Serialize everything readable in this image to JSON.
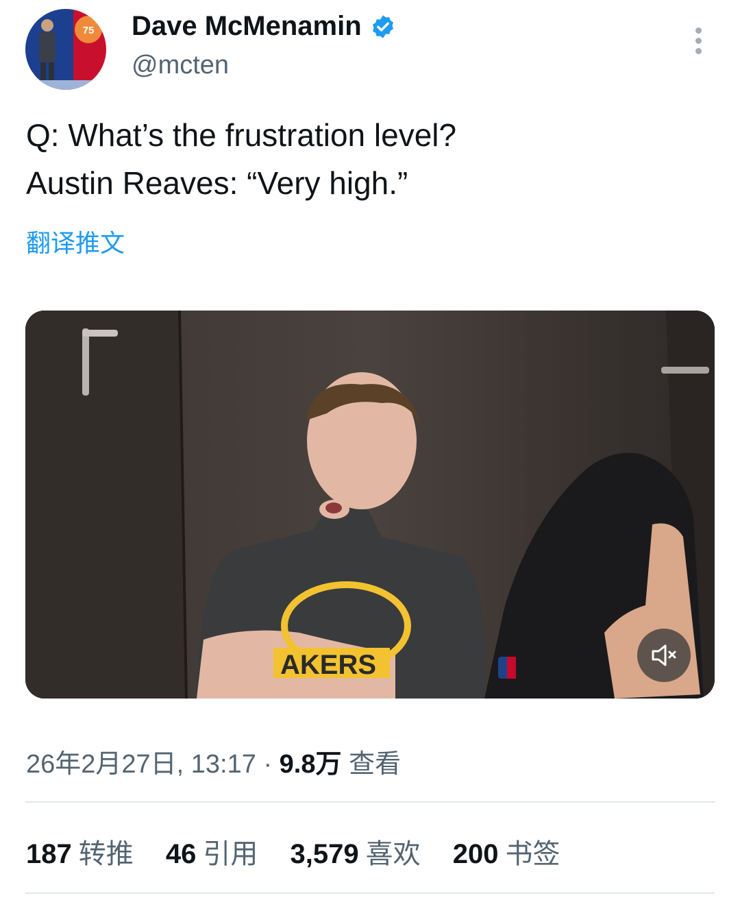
{
  "author": {
    "display_name": "Dave McMenamin",
    "handle": "@mcten",
    "verified": true,
    "avatar_badge": "75"
  },
  "tweet": {
    "lines": [
      "Q: What’s the frustration level?",
      "Austin Reaves: “Very high.”"
    ],
    "translate_label": "翻译推文"
  },
  "media": {
    "jersey_text": "AKERS",
    "mute_icon": "speaker-muted-icon"
  },
  "meta": {
    "timestamp": "26年2月27日, 13:17",
    "separator": "·",
    "views_count": "9.8万",
    "views_label": "查看"
  },
  "stats": [
    {
      "count": "187",
      "label": "转推"
    },
    {
      "count": "46",
      "label": "引用"
    },
    {
      "count": "3,579",
      "label": "喜欢"
    },
    {
      "count": "200",
      "label": "书签"
    }
  ],
  "colors": {
    "accent": "#1d9bf0",
    "secondary_text": "#536471",
    "primary_text": "#0f1419"
  }
}
